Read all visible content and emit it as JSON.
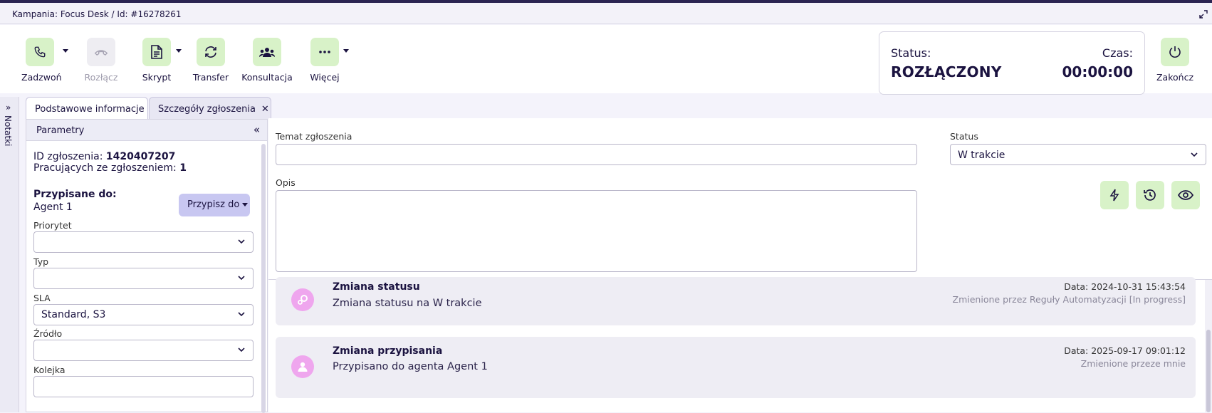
{
  "title_bar": {
    "text": "Kampania: Focus Desk / Id: #16278261"
  },
  "toolbar": {
    "buttons": [
      {
        "label": "Zadzwoń",
        "icon": "phone-icon",
        "disabled": false
      },
      {
        "label": "Rozłącz",
        "icon": "hangup-icon",
        "disabled": true
      },
      {
        "label": "Skrypt",
        "icon": "document-icon",
        "disabled": false
      },
      {
        "label": "Transfer",
        "icon": "transfer-icon",
        "disabled": false
      },
      {
        "label": "Konsultacja",
        "icon": "group-icon",
        "disabled": false
      },
      {
        "label": "Więcej",
        "icon": "more-icon",
        "disabled": false
      }
    ],
    "end_label": "Zakończ"
  },
  "status_box": {
    "status_label": "Status:",
    "status_value": "ROZŁĄCZONY",
    "time_label": "Czas:",
    "time_value": "00:00:00"
  },
  "notes": {
    "label": "Notatki"
  },
  "tabs": [
    {
      "label": "Podstawowe informacje"
    },
    {
      "label": "Szczegóły zgłoszenia"
    }
  ],
  "params": {
    "header": "Parametry",
    "id_label": "ID zgłoszenia:",
    "id_value": "1420407207",
    "working_label": "Pracujących ze zgłoszeniem:",
    "working_value": "1",
    "assigned_label": "Przypisane do:",
    "assigned_value": "Agent 1",
    "assign_button": "Przypisz do",
    "fields": [
      {
        "label": "Priorytet",
        "value": ""
      },
      {
        "label": "Typ",
        "value": ""
      },
      {
        "label": "SLA",
        "value": "Standard, S3"
      },
      {
        "label": "Źródło",
        "value": ""
      },
      {
        "label": "Kolejka",
        "value": ""
      }
    ]
  },
  "details": {
    "subject_label": "Temat zgłoszenia",
    "subject_value": "",
    "status_label": "Status",
    "status_value": "W trakcie",
    "description_label": "Opis",
    "description_value": ""
  },
  "history": [
    {
      "title": "Zmiana statusu",
      "description": "Zmiana statusu na W trakcie",
      "date": "Data: 2024-10-31 15:43:54",
      "changed_by": "Zmienione przez Reguły Automatyzacji [In progress]",
      "icon": "gears-icon"
    },
    {
      "title": "Zmiana przypisania",
      "description": "Przypisano do agenta Agent 1",
      "date": "Data: 2025-09-17 09:01:12",
      "changed_by": "Zmienione przeze mnie",
      "icon": "user-icon"
    }
  ],
  "colors": {
    "accent_green": "#d8f2c8",
    "accent_purple": "#c8c7f1",
    "avatar_pink": "#efa6ee",
    "text_dark": "#1b1340"
  }
}
